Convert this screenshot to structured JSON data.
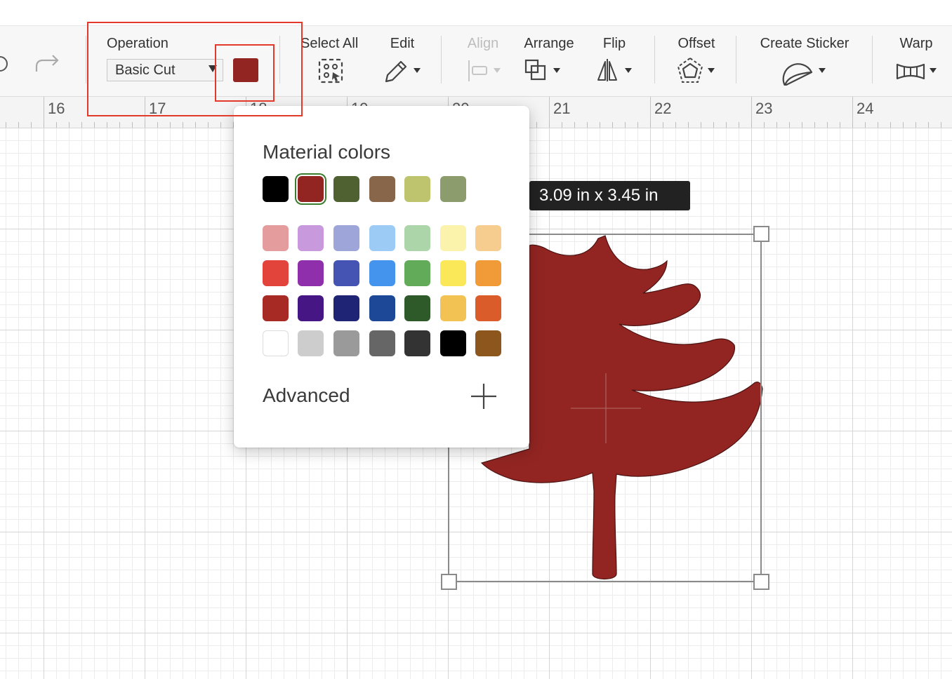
{
  "toolbar": {
    "operation_label": "Operation",
    "operation_value": "Basic Cut",
    "selected_color": "#922522",
    "select_all_label": "Select All",
    "edit_label": "Edit",
    "align_label": "Align",
    "arrange_label": "Arrange",
    "flip_label": "Flip",
    "offset_label": "Offset",
    "create_sticker_label": "Create Sticker",
    "warp_label": "Warp"
  },
  "ruler": {
    "numbers": [
      "16",
      "17",
      "18",
      "19",
      "20",
      "21",
      "22",
      "23",
      "24"
    ]
  },
  "selection": {
    "size_text": "3.09  in x 3.45  in",
    "fill_color": "#922522"
  },
  "color_popover": {
    "title": "Material colors",
    "material_colors": [
      "#000000",
      "#922522",
      "#4f6130",
      "#876649",
      "#bec46d",
      "#8d9c6d"
    ],
    "selected_index": 1,
    "palette": [
      [
        "#e59c9c",
        "#c899dc",
        "#9ea6d9",
        "#9ccbf5",
        "#acd6a9",
        "#fbf3ac",
        "#f7cc8f"
      ],
      [
        "#e2443c",
        "#8f2fab",
        "#4553b3",
        "#4494ee",
        "#62ab58",
        "#fbe859",
        "#f09b38"
      ],
      [
        "#a72a24",
        "#461784",
        "#1f2474",
        "#1d4797",
        "#2e5a2a",
        "#f2c352",
        "#d95c2a"
      ],
      [
        "#ffffff",
        "#cdcdcd",
        "#9a9a9a",
        "#666666",
        "#333333",
        "#000000",
        "#8d561c"
      ]
    ],
    "advanced_label": "Advanced"
  }
}
